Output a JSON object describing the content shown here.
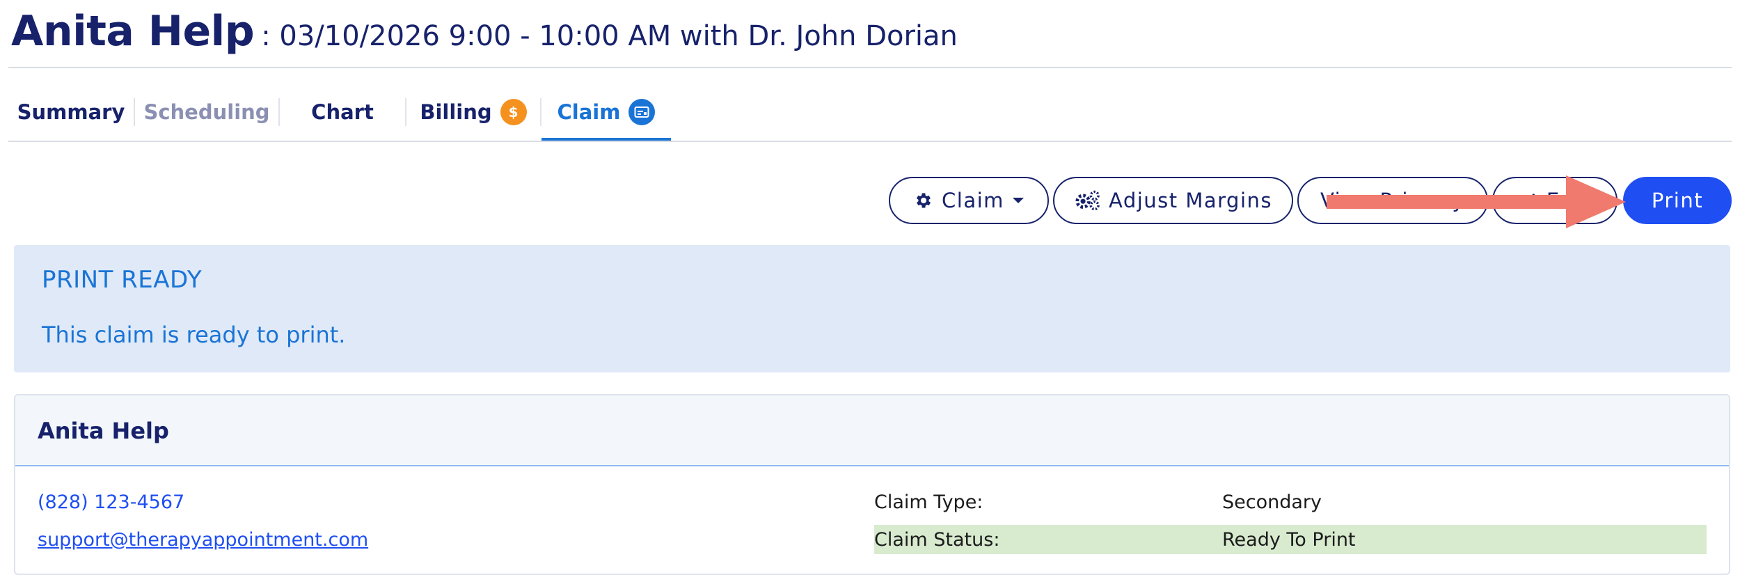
{
  "header": {
    "patient_name": "Anita Help",
    "appointment": ": 03/10/2026 9:00 - 10:00 AM with Dr. John Dorian"
  },
  "tabs": [
    {
      "label": "Summary",
      "state": "normal"
    },
    {
      "label": "Scheduling",
      "state": "disabled"
    },
    {
      "label": "Chart",
      "state": "normal"
    },
    {
      "label": "Billing",
      "state": "normal",
      "badge_icon": "dollar-icon",
      "badge_text": "$",
      "badge_color": "#f5911e"
    },
    {
      "label": "Claim",
      "state": "active",
      "badge_icon": "claim-card-icon",
      "badge_color": "#1a74d6"
    }
  ],
  "toolbar": {
    "claim_label": "Claim",
    "claim_icon": "gear-icon",
    "adjust_margins_label": "Adjust Margins",
    "adjust_margins_icon": "gears-icon",
    "view_primary_label": "View Primary",
    "edit_label": "Edit",
    "edit_icon": "pencil-icon",
    "print_label": "Print"
  },
  "alert": {
    "title": "PRINT READY",
    "message": "This claim is ready to print."
  },
  "patient_card": {
    "name": "Anita Help",
    "phone": "(828) 123-4567",
    "email": "support@therapyappointment.com",
    "details": [
      {
        "label": "Claim Type:",
        "value": "Secondary"
      },
      {
        "label": "Claim Status:",
        "value": "Ready To Print"
      }
    ]
  },
  "colors": {
    "brand_navy": "#17226b",
    "accent_blue": "#1a74d6",
    "primary_button": "#1f4ff2",
    "alert_background": "#dfe9f7",
    "status_highlight": "#d8ebcf",
    "annotation_arrow": "#f07a6e"
  }
}
